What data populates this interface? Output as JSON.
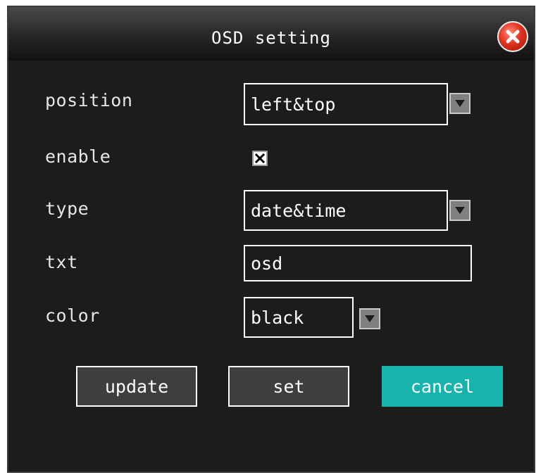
{
  "dialog": {
    "title": "OSD setting",
    "close_icon": "close-x-icon"
  },
  "form": {
    "position": {
      "label": "position",
      "value": "left&top"
    },
    "enable": {
      "label": "enable",
      "checked": true
    },
    "type": {
      "label": "type",
      "value": "date&time"
    },
    "txt": {
      "label": "txt",
      "value": "osd"
    },
    "color": {
      "label": "color",
      "value": "black"
    }
  },
  "buttons": {
    "update": "update",
    "set": "set",
    "cancel": "cancel"
  },
  "colors": {
    "background": "#1c1c1c",
    "accent": "#17b3ad",
    "close": "#e0331f"
  }
}
